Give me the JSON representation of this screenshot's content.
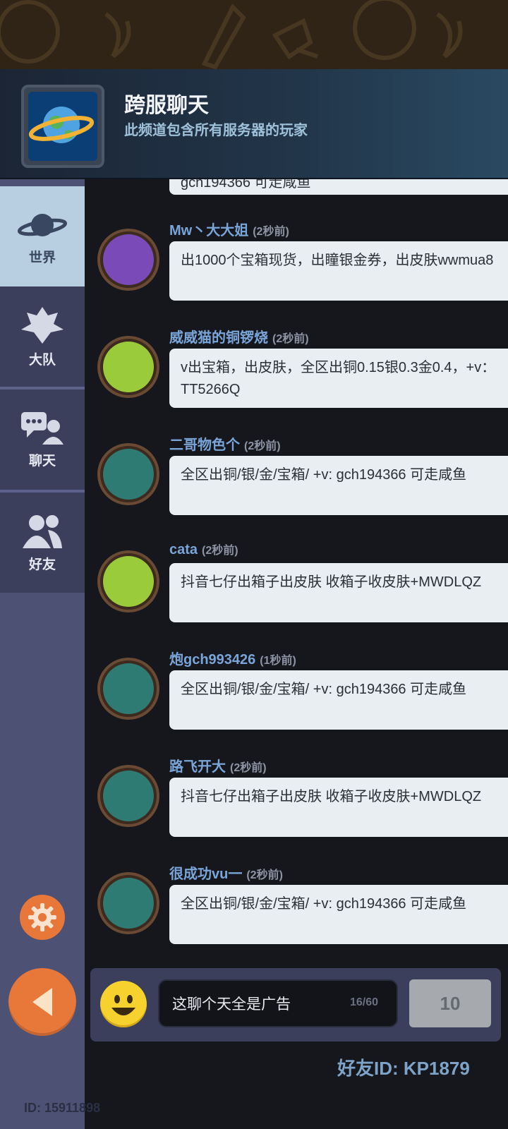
{
  "header": {
    "title": "跨服聊天",
    "subtitle": "此频道包含所有服务器的玩家",
    "icon": "planet-icon"
  },
  "sidebar": {
    "tabs": [
      {
        "label": "世界",
        "icon": "planet-icon",
        "active": true
      },
      {
        "label": "大队",
        "icon": "team-icon",
        "active": false
      },
      {
        "label": "聊天",
        "icon": "chat-icon",
        "active": false
      },
      {
        "label": "好友",
        "icon": "friends-icon",
        "active": false
      }
    ],
    "settings_icon": "gear-icon",
    "back_icon": "back-arrow-icon",
    "user_id": "ID: 15911898"
  },
  "messages": [
    {
      "name": "Mw丶大大姐",
      "time": "(2秒前)",
      "text": "出1000个宝箱现货，出瞳银金券，出皮肤wwmua8",
      "avatar": "purple"
    },
    {
      "name": "威威猫的铜锣烧",
      "time": "(2秒前)",
      "text": "v出宝箱，出皮肤，全区出铜0.15银0.3金0.4，+v：TT5266Q",
      "avatar": "green"
    },
    {
      "name": "二哥物色个",
      "time": "(2秒前)",
      "text": "全区出铜/银/金/宝箱/ +v: gch194366 可走咸鱼",
      "avatar": "teal"
    },
    {
      "name": "cata",
      "time": "(2秒前)",
      "text": "抖音七仔出箱子出皮肤 收箱子收皮肤+MWDLQZ",
      "avatar": "green"
    },
    {
      "name": "炮gch993426",
      "time": "(1秒前)",
      "text": "全区出铜/银/金/宝箱/ +v: gch194366 可走咸鱼",
      "avatar": "teal"
    },
    {
      "name": "路飞开大",
      "time": "(2秒前)",
      "text": "抖音七仔出箱子出皮肤 收箱子收皮肤+MWDLQZ",
      "avatar": "teal"
    },
    {
      "name": "很成功vu一",
      "time": "(2秒前)",
      "text": "全区出铜/银/金/宝箱/ +v: gch194366 可走咸鱼",
      "avatar": "teal"
    }
  ],
  "partial_top_message": "gch194366 可走咸鱼",
  "input": {
    "value": "这聊个天全是广告",
    "char_count": "16/60",
    "send_label": "10"
  },
  "friend_id": "好友ID: KP1879",
  "colors": {
    "accent_orange": "#e8773a",
    "name_blue": "#7aa5d8",
    "sidebar_active": "#b8cfe2"
  }
}
